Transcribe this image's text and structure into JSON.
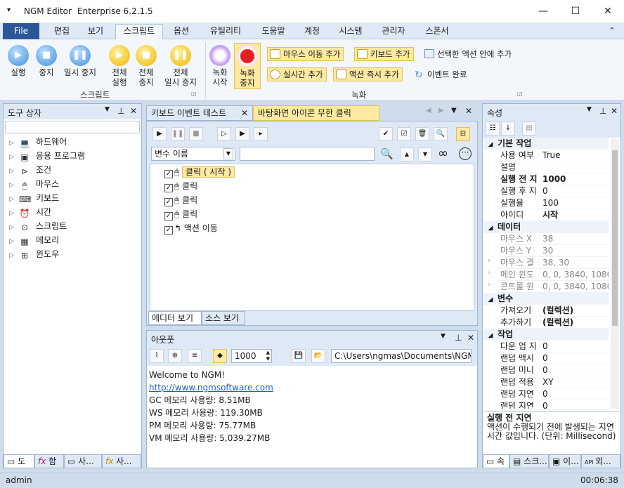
{
  "window": {
    "app_name": "NGM Editor",
    "edition": "Enterprise 6.2.1.5"
  },
  "menu": {
    "file": "File",
    "items": [
      "편집",
      "보기",
      "스크립트",
      "옵션",
      "유틸리티",
      "도움말",
      "계정",
      "시스템",
      "관리자",
      "스폰서"
    ],
    "active_index": 2
  },
  "ribbon": {
    "script_group": "스크립트",
    "record_group": "녹화",
    "run": "실행",
    "stop": "중지",
    "pause": "일시 중지",
    "run_all": [
      "전체",
      "실행"
    ],
    "stop_all": [
      "전체",
      "중지"
    ],
    "pause_all": [
      "전체",
      "일시 중지"
    ],
    "record_start": [
      "녹화",
      "시작"
    ],
    "record_stop": [
      "녹화",
      "중지"
    ],
    "add_mouse_move": "마우스 이동 추가",
    "add_keyboard": "키보드 추가",
    "add_inside_selected": "선택한 액션 안에 추가",
    "add_realtime": "실시간 추가",
    "add_action_now": "액션 즉시 추가",
    "event_done": "이벤트 완료"
  },
  "toolbox": {
    "title": "도구 상자",
    "items": [
      "하드웨어",
      "응용 프로그램",
      "조건",
      "마우스",
      "키보드",
      "시간",
      "스크립트",
      "메모리",
      "윈도우"
    ],
    "bottom_tabs": [
      "도",
      "함",
      "사...",
      "사..."
    ]
  },
  "editor": {
    "tabs": [
      "키보드 이벤트 테스트",
      "바탕화면 아이콘 무한 클릭"
    ],
    "var_select": "변수 이름",
    "actions": [
      {
        "checked": true,
        "label": "클릭 ( 시작 )",
        "selected": true
      },
      {
        "checked": true,
        "label": "클릭"
      },
      {
        "checked": true,
        "label": "클릭"
      },
      {
        "checked": true,
        "label": "클릭"
      },
      {
        "checked": true,
        "label": "액션 이동"
      }
    ],
    "view_tabs": [
      "에디터 보기",
      "소스 보기"
    ]
  },
  "output": {
    "title": "아웃풋",
    "count": "1000",
    "path": "C:\\Users\\ngmas\\Documents\\NGM6\\",
    "lines": [
      "Welcome to NGM!",
      "http://www.ngmsoftware.com",
      "GC 메모리 사용량: 8.51MB",
      "WS 메모리 사용량: 119.30MB",
      "PM 메모리 사용량: 75.77MB",
      "VM 메모리 사용량: 5,039.27MB"
    ]
  },
  "properties": {
    "title": "속성",
    "cat_basic": "기본 작업",
    "cat_data": "데이터",
    "cat_var": "변수",
    "cat_job": "작업",
    "basic": [
      [
        "사용 여부",
        "True"
      ],
      [
        "설명",
        ""
      ],
      [
        "실행 전 지",
        "1000"
      ],
      [
        "실행 후 지",
        "0"
      ],
      [
        "실행율",
        "100"
      ],
      [
        "아이디",
        "시작"
      ]
    ],
    "data": [
      [
        "마우스 X",
        "38"
      ],
      [
        "마우스 Y",
        "30"
      ],
      [
        "마우스 결",
        "38, 30"
      ],
      [
        "메인 윈도",
        "0, 0, 3840, 1080"
      ],
      [
        "콘트롤 윈",
        "0, 0, 3840, 1080"
      ]
    ],
    "var": [
      [
        "가져오기",
        "(컬렉션)"
      ],
      [
        "추가하기",
        "(컬렉션)"
      ]
    ],
    "job": [
      [
        "다운 업 지",
        "0"
      ],
      [
        "랜덤 맥시",
        "0"
      ],
      [
        "랜덤 미니",
        "0"
      ],
      [
        "랜덤 적용",
        "XY"
      ],
      [
        "랜덤 지연",
        "0"
      ],
      [
        "랜덤 지연",
        "0"
      ]
    ],
    "desc_title": "실행 전 지연",
    "desc_text": "액션이 수행되기 전에 발생되는 지연 시간 값입니다. (단위: Millisecond)",
    "bottom_tabs": [
      "속",
      "스크...",
      "이...",
      "외..."
    ]
  },
  "status": {
    "user": "admin",
    "time": "00:06:38"
  }
}
